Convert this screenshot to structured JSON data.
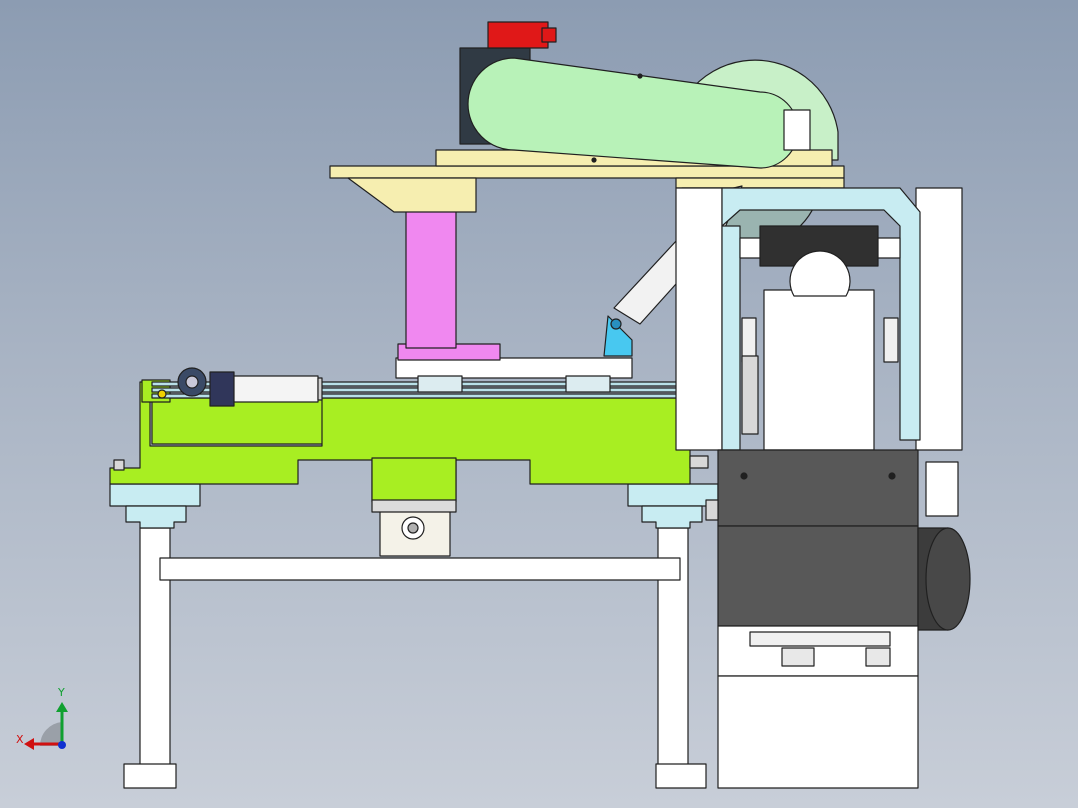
{
  "axis_triad": {
    "x_label": "X",
    "y_label": "Y"
  },
  "colors": {
    "background_top": "#8c9cb2",
    "background_bottom": "#c8ced8",
    "frame": "#ffffff",
    "table": "#a8ee22",
    "top_plate": "#f6eeb0",
    "column": "#f088f0",
    "belt_cover": "#b8f2b8",
    "blade": "#c8f0c8",
    "motor_top": "#e01818",
    "guide_frame": "#c8ecf2",
    "pivot_bracket": "#48c8f0",
    "base_box": "#585858",
    "motor_cylinder": "#3c3c3c",
    "outline": "#202020"
  },
  "icons": [
    "axis-triad-icon"
  ]
}
